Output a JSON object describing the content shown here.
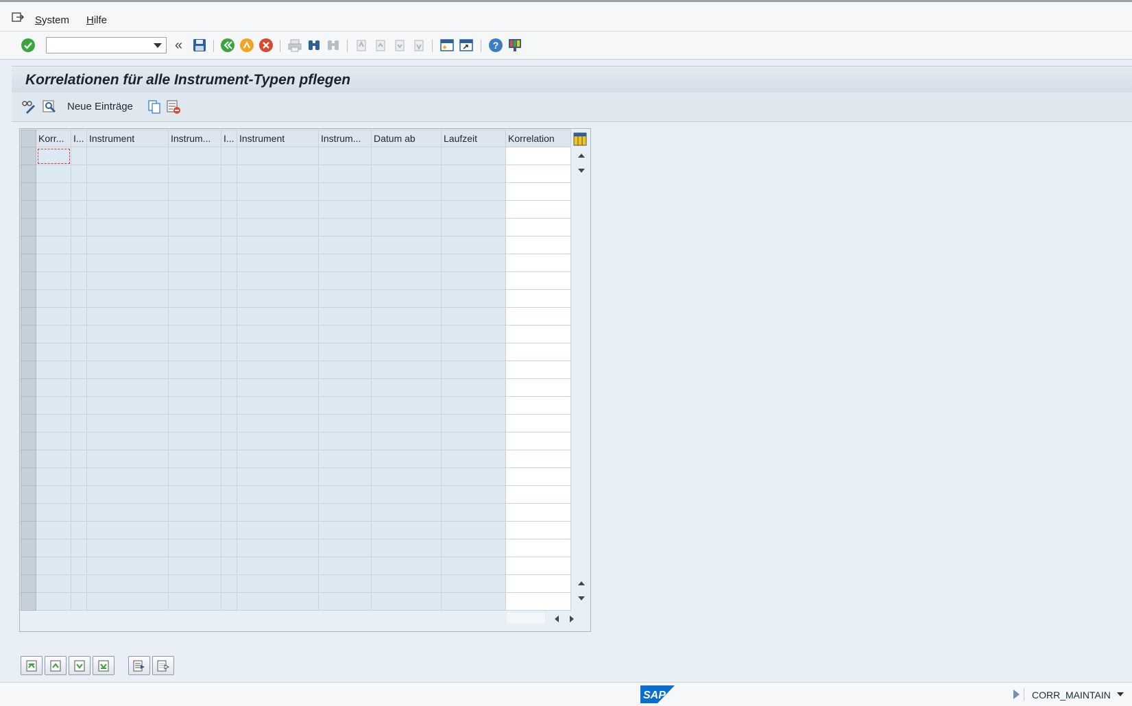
{
  "menu": {
    "items": [
      {
        "label": "System"
      },
      {
        "label": "Hilfe"
      }
    ]
  },
  "system_toolbar": {
    "command_field_value": "",
    "icons": [
      "enter-icon",
      "back-icon",
      "exit-icon",
      "cancel-icon",
      "print-icon",
      "find-icon",
      "find-next-icon",
      "first-page-icon",
      "previous-page-icon",
      "next-page-icon",
      "last-page-icon",
      "create-session-icon",
      "generate-shortcut-icon",
      "help-icon",
      "layout-menu-icon"
    ]
  },
  "title": "Korrelationen für alle Instrument-Typen pflegen",
  "app_toolbar": {
    "new_entries_label": "Neue Einträge"
  },
  "table": {
    "columns": [
      {
        "label": "Korr..."
      },
      {
        "label": "I..."
      },
      {
        "label": "Instrument"
      },
      {
        "label": "Instrum..."
      },
      {
        "label": "I..."
      },
      {
        "label": "Instrument"
      },
      {
        "label": "Instrum..."
      },
      {
        "label": "Datum ab"
      },
      {
        "label": "Laufzeit"
      },
      {
        "label": "Korrelation"
      }
    ],
    "row_count": 26,
    "rows": []
  },
  "statusbar": {
    "logo_text": "SAP",
    "transaction": "CORR_MAINTAIN"
  },
  "colors": {
    "background": "#e9eff6",
    "table_cell": "#dce8f2",
    "editable_cell": "#ffffff",
    "sap_blue": "#0a6ed1"
  }
}
